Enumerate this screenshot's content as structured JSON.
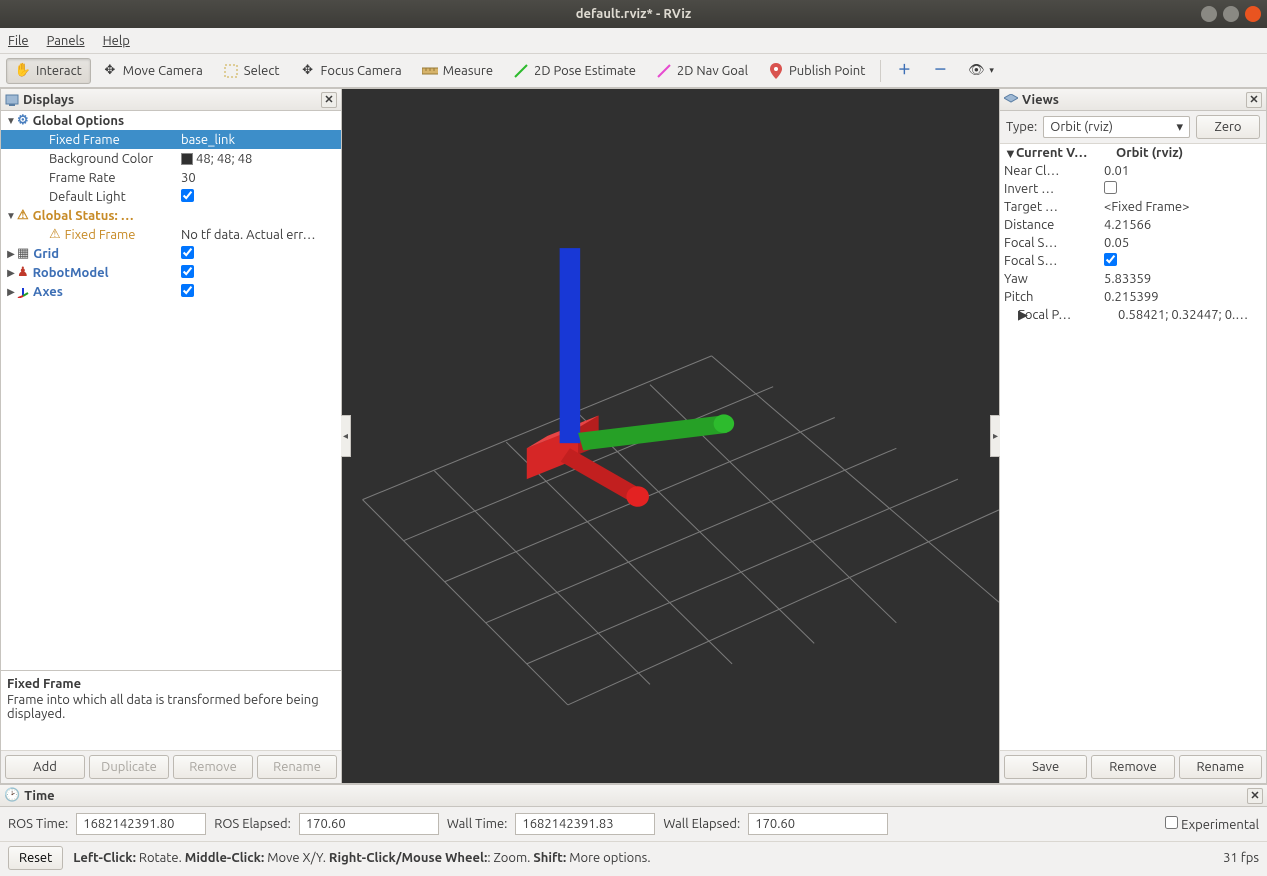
{
  "window": {
    "title": "default.rviz* - RViz"
  },
  "menu": {
    "file": "File",
    "panels": "Panels",
    "help": "Help"
  },
  "toolbar": {
    "interact": "Interact",
    "move_camera": "Move Camera",
    "select": "Select",
    "focus_camera": "Focus Camera",
    "measure": "Measure",
    "pose_estimate": "2D Pose Estimate",
    "nav_goal": "2D Nav Goal",
    "publish_point": "Publish Point"
  },
  "displays": {
    "title": "Displays",
    "global_options": "Global Options",
    "fixed_frame_label": "Fixed Frame",
    "fixed_frame_value": "base_link",
    "background_color_label": "Background Color",
    "background_color_value": "48; 48; 48",
    "frame_rate_label": "Frame Rate",
    "frame_rate_value": "30",
    "default_light_label": "Default Light",
    "global_status_label": "Global Status: …",
    "status_fixed_frame_label": "Fixed Frame",
    "status_fixed_frame_value": "No tf data.  Actual err…",
    "grid_label": "Grid",
    "robotmodel_label": "RobotModel",
    "axes_label": "Axes",
    "desc_title": "Fixed Frame",
    "desc_body": "Frame into which all data is transformed before being displayed.",
    "btn_add": "Add",
    "btn_duplicate": "Duplicate",
    "btn_remove": "Remove",
    "btn_rename": "Rename"
  },
  "views": {
    "title": "Views",
    "type_label": "Type:",
    "type_value": "Orbit (rviz)",
    "zero": "Zero",
    "current_view_label": "Current V…",
    "current_view_value": "Orbit (rviz)",
    "near_clip_label": "Near Cl…",
    "near_clip_value": "0.01",
    "invert_label": "Invert …",
    "target_label": "Target …",
    "target_value": "<Fixed Frame>",
    "distance_label": "Distance",
    "distance_value": "4.21566",
    "focal_shape_size_label": "Focal S…",
    "focal_shape_size_value": "0.05",
    "focal_shape_fixed_label": "Focal S…",
    "yaw_label": "Yaw",
    "yaw_value": "5.83359",
    "pitch_label": "Pitch",
    "pitch_value": "0.215399",
    "focal_point_label": "Focal P…",
    "focal_point_value": "0.58421; 0.32447; 0.…",
    "btn_save": "Save",
    "btn_remove": "Remove",
    "btn_rename": "Rename"
  },
  "time": {
    "title": "Time",
    "ros_time_label": "ROS Time:",
    "ros_time_value": "1682142391.80",
    "ros_elapsed_label": "ROS Elapsed:",
    "ros_elapsed_value": "170.60",
    "wall_time_label": "Wall Time:",
    "wall_time_value": "1682142391.83",
    "wall_elapsed_label": "Wall Elapsed:",
    "wall_elapsed_value": "170.60",
    "experimental": "Experimental"
  },
  "status": {
    "reset": "Reset",
    "hint_left_b": "Left-Click:",
    "hint_left": " Rotate. ",
    "hint_mid_b": "Middle-Click:",
    "hint_mid": " Move X/Y. ",
    "hint_right_b": "Right-Click/Mouse Wheel:",
    "hint_right": ": Zoom. ",
    "hint_shift_b": "Shift:",
    "hint_shift": " More options.",
    "fps": "31 fps"
  }
}
